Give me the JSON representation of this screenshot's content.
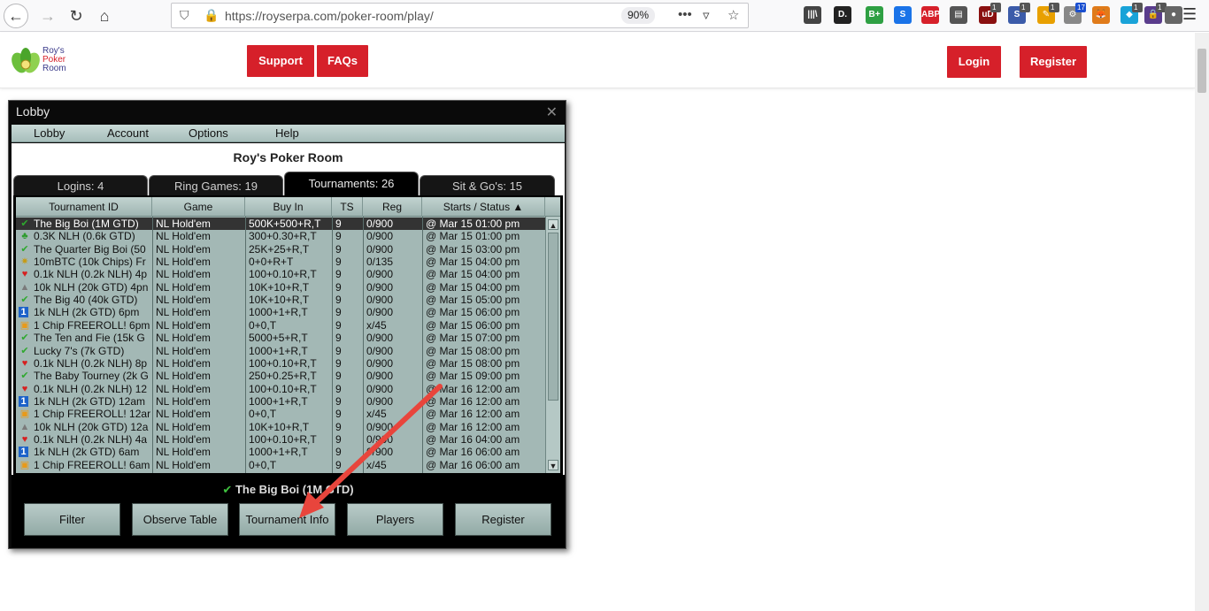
{
  "browser": {
    "url": "https://royserpa.com/poker-room/play/",
    "zoom": "90%",
    "menu_dots": "•••",
    "extensions": [
      {
        "name": "library-icon",
        "label": "|||\\",
        "color": "#444444",
        "badge": ""
      },
      {
        "name": "reader-icon",
        "label": "D.",
        "color": "#222222",
        "badge": ""
      },
      {
        "name": "bplus-icon",
        "label": "B+",
        "color": "#2ea043",
        "badge": ""
      },
      {
        "name": "s-icon",
        "label": "S",
        "color": "#1a73e8",
        "badge": ""
      },
      {
        "name": "adblock-icon",
        "label": "ABP",
        "color": "#d6202a",
        "badge": ""
      },
      {
        "name": "sidebar-icon",
        "label": "▤",
        "color": "#555555",
        "badge": ""
      },
      {
        "name": "ublock-icon",
        "label": "uD",
        "color": "#8a1010",
        "badge": "1"
      },
      {
        "name": "sync-icon",
        "label": "S",
        "color": "#3b5ba9",
        "badge": "1"
      },
      {
        "name": "pen-icon",
        "label": "✎",
        "color": "#e8a000",
        "badge": "1"
      },
      {
        "name": "gear-ext-icon",
        "label": "⚙",
        "color": "#888888",
        "badge": "17"
      },
      {
        "name": "fox-icon",
        "label": "🦊",
        "color": "#e07b1a",
        "badge": ""
      },
      {
        "name": "cube-icon",
        "label": "◆",
        "color": "#19a3d8",
        "badge": "1"
      },
      {
        "name": "lock-ext-icon",
        "label": "🔒",
        "color": "#5a3c8c",
        "badge": "1"
      },
      {
        "name": "ball-icon",
        "label": "●",
        "color": "#666666",
        "badge": ""
      }
    ]
  },
  "site": {
    "logo_lines": [
      "Roy's",
      "Poker",
      "Room"
    ],
    "support": "Support",
    "faqs": "FAQs",
    "login": "Login",
    "register": "Register"
  },
  "lobby": {
    "title": "Lobby",
    "close": "✕",
    "menu": [
      "Lobby",
      "Account",
      "Options",
      "Help"
    ],
    "room_title": "Roy's Poker Room",
    "tabs": [
      {
        "label": "Logins: 4",
        "active": false
      },
      {
        "label": "Ring Games: 19",
        "active": false
      },
      {
        "label": "Tournaments: 26",
        "active": true
      },
      {
        "label": "Sit & Go's: 15",
        "active": false
      }
    ],
    "columns": [
      "Tournament ID",
      "Game",
      "Buy In",
      "TS",
      "Reg",
      "Starts / Status ▲"
    ],
    "rows": [
      {
        "icon": "check",
        "name": "The Big Boi (1M GTD)",
        "game": "NL Hold'em",
        "buyin": "500K+500+R,T",
        "ts": "9",
        "reg": "0/900",
        "start": "@ Mar 15 01:00 pm"
      },
      {
        "icon": "club",
        "name": "0.3K NLH (0.6k GTD)",
        "game": "NL Hold'em",
        "buyin": "300+0.30+R,T",
        "ts": "9",
        "reg": "0/900",
        "start": "@ Mar 15 01:00 pm"
      },
      {
        "icon": "check",
        "name": "The Quarter Big Boi (50",
        "game": "NL Hold'em",
        "buyin": "25K+25+R,T",
        "ts": "9",
        "reg": "0/900",
        "start": "@ Mar 15 03:00 pm"
      },
      {
        "icon": "star",
        "name": "10mBTC (10k Chips) Fr",
        "game": "NL Hold'em",
        "buyin": "0+0+R+T",
        "ts": "9",
        "reg": "0/135",
        "start": "@ Mar 15 04:00 pm"
      },
      {
        "icon": "heart",
        "name": "0.1k NLH (0.2k NLH) 4p",
        "game": "NL Hold'em",
        "buyin": "100+0.10+R,T",
        "ts": "9",
        "reg": "0/900",
        "start": "@ Mar 15 04:00 pm"
      },
      {
        "icon": "mountain",
        "name": "10k NLH (20k GTD) 4pn",
        "game": "NL Hold'em",
        "buyin": "10K+10+R,T",
        "ts": "9",
        "reg": "0/900",
        "start": "@ Mar 15 04:00 pm"
      },
      {
        "icon": "check",
        "name": "The Big 40 (40k GTD)",
        "game": "NL Hold'em",
        "buyin": "10K+10+R,T",
        "ts": "9",
        "reg": "0/900",
        "start": "@ Mar 15 05:00 pm"
      },
      {
        "icon": "one",
        "name": "1k NLH (2k GTD) 6pm",
        "game": "NL Hold'em",
        "buyin": "1000+1+R,T",
        "ts": "9",
        "reg": "0/900",
        "start": "@ Mar 15 06:00 pm"
      },
      {
        "icon": "gift",
        "name": "1 Chip FREEROLL! 6pm",
        "game": "NL Hold'em",
        "buyin": "0+0,T",
        "ts": "9",
        "reg": "x/45",
        "start": "@ Mar 15 06:00 pm"
      },
      {
        "icon": "check",
        "name": "The Ten and Fie (15k G",
        "game": "NL Hold'em",
        "buyin": "5000+5+R,T",
        "ts": "9",
        "reg": "0/900",
        "start": "@ Mar 15 07:00 pm"
      },
      {
        "icon": "check",
        "name": "Lucky 7's (7k GTD)",
        "game": "NL Hold'em",
        "buyin": "1000+1+R,T",
        "ts": "9",
        "reg": "0/900",
        "start": "@ Mar 15 08:00 pm"
      },
      {
        "icon": "heart",
        "name": "0.1k NLH (0.2k NLH) 8p",
        "game": "NL Hold'em",
        "buyin": "100+0.10+R,T",
        "ts": "9",
        "reg": "0/900",
        "start": "@ Mar 15 08:00 pm"
      },
      {
        "icon": "check",
        "name": "The Baby Tourney (2k G",
        "game": "NL Hold'em",
        "buyin": "250+0.25+R,T",
        "ts": "9",
        "reg": "0/900",
        "start": "@ Mar 15 09:00 pm"
      },
      {
        "icon": "heart",
        "name": "0.1k NLH (0.2k NLH) 12",
        "game": "NL Hold'em",
        "buyin": "100+0.10+R,T",
        "ts": "9",
        "reg": "0/900",
        "start": "@ Mar 16 12:00 am"
      },
      {
        "icon": "one",
        "name": "1k NLH (2k GTD) 12am",
        "game": "NL Hold'em",
        "buyin": "1000+1+R,T",
        "ts": "9",
        "reg": "0/900",
        "start": "@ Mar 16 12:00 am"
      },
      {
        "icon": "gift",
        "name": "1 Chip FREEROLL! 12ar",
        "game": "NL Hold'em",
        "buyin": "0+0,T",
        "ts": "9",
        "reg": "x/45",
        "start": "@ Mar 16 12:00 am"
      },
      {
        "icon": "mountain",
        "name": "10k NLH (20k GTD) 12a",
        "game": "NL Hold'em",
        "buyin": "10K+10+R,T",
        "ts": "9",
        "reg": "0/900",
        "start": "@ Mar 16 12:00 am"
      },
      {
        "icon": "heart",
        "name": "0.1k NLH (0.2k NLH) 4a",
        "game": "NL Hold'em",
        "buyin": "100+0.10+R,T",
        "ts": "9",
        "reg": "0/900",
        "start": "@ Mar 16 04:00 am"
      },
      {
        "icon": "one",
        "name": "1k NLH (2k GTD) 6am",
        "game": "NL Hold'em",
        "buyin": "1000+1+R,T",
        "ts": "9",
        "reg": "0/900",
        "start": "@ Mar 16 06:00 am"
      },
      {
        "icon": "gift",
        "name": "1 Chip FREEROLL! 6am",
        "game": "NL Hold'em",
        "buyin": "0+0,T",
        "ts": "9",
        "reg": "x/45",
        "start": "@ Mar 16 06:00 am"
      }
    ],
    "selected": "The Big Boi (1M GTD)",
    "buttons": [
      "Filter",
      "Observe Table",
      "Tournament Info",
      "Players",
      "Register"
    ]
  }
}
